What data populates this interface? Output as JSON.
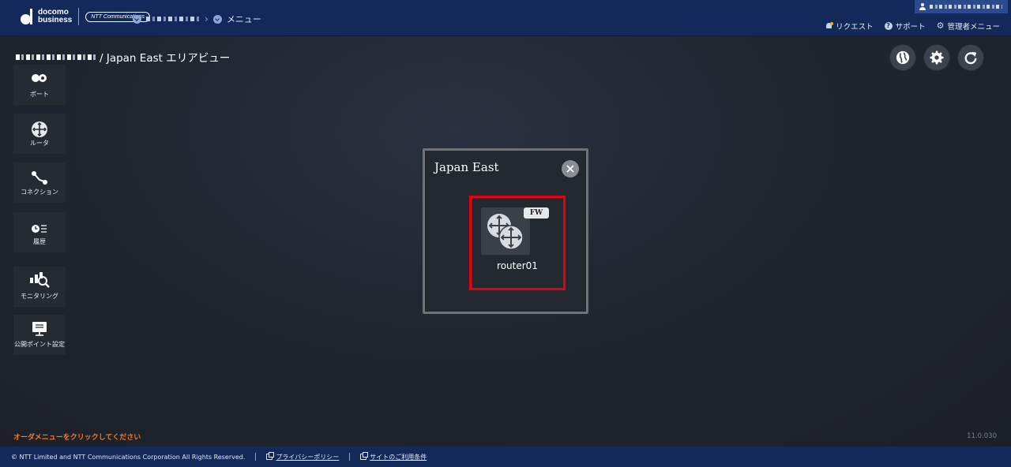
{
  "header": {
    "brand_line1": "docomo",
    "brand_line2": "business",
    "ntt_logo": "NTT Communications",
    "menu_label": "メニュー",
    "links": {
      "request": "リクエスト",
      "support": "サポート",
      "admin_menu": "管理者メニュー"
    }
  },
  "page": {
    "title_suffix": "/ Japan East エリアビュー"
  },
  "toolbar": {
    "icons": [
      "globe-icon",
      "gear-icon",
      "refresh-icon"
    ]
  },
  "sidebar": {
    "items": [
      {
        "label": "ポート",
        "icon": "port-icon"
      },
      {
        "label": "ルータ",
        "icon": "router-icon"
      },
      {
        "label": "コネクション",
        "icon": "connection-icon"
      },
      {
        "label": "履歴",
        "icon": "history-icon"
      },
      {
        "label": "モニタリング",
        "icon": "monitoring-icon"
      },
      {
        "label": "公開ポイント設定",
        "icon": "public-point-icon"
      }
    ]
  },
  "area_dialog": {
    "title": "Japan East",
    "router": {
      "name": "router01",
      "badge": "FW"
    }
  },
  "hint": "オーダメニューをクリックしてください",
  "version": "11.0.030",
  "footer": {
    "copyright": "© NTT Limited and NTT Communications Corporation All Rights Reserved.",
    "privacy_policy": "プライバシーポリシー",
    "terms": "サイトのご利用条件"
  },
  "colors": {
    "header_bg": "#12295a",
    "highlight": "#e60012",
    "hint": "#f07a2a"
  }
}
